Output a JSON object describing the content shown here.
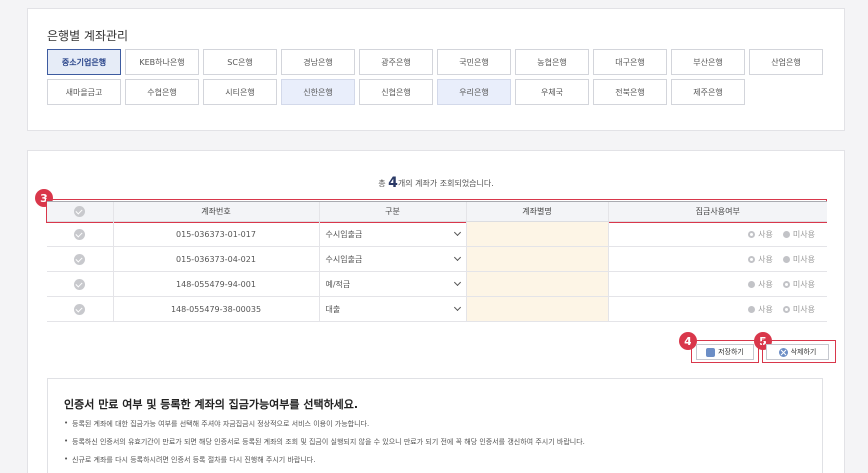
{
  "bank_panel": {
    "title": "은행별 계좌관리",
    "rows": [
      [
        {
          "label": "중소기업은행",
          "state": "selected"
        },
        {
          "label": "KEB하나은행",
          "state": ""
        },
        {
          "label": "SC은행",
          "state": ""
        },
        {
          "label": "경남은행",
          "state": ""
        },
        {
          "label": "광주은행",
          "state": ""
        },
        {
          "label": "국민은행",
          "state": ""
        },
        {
          "label": "농협은행",
          "state": ""
        },
        {
          "label": "대구은행",
          "state": ""
        },
        {
          "label": "부산은행",
          "state": ""
        },
        {
          "label": "산업은행",
          "state": ""
        }
      ],
      [
        {
          "label": "새마을금고",
          "state": ""
        },
        {
          "label": "수협은행",
          "state": ""
        },
        {
          "label": "시티은행",
          "state": ""
        },
        {
          "label": "신한은행",
          "state": "highlight"
        },
        {
          "label": "신협은행",
          "state": ""
        },
        {
          "label": "우리은행",
          "state": "highlight"
        },
        {
          "label": "우체국",
          "state": ""
        },
        {
          "label": "전북은행",
          "state": ""
        },
        {
          "label": "제주은행",
          "state": ""
        }
      ]
    ]
  },
  "summary": {
    "prefix": "총",
    "count": "4",
    "suffix": "개의 계좌가 조회되었습니다."
  },
  "annotations": {
    "table_marker": "3",
    "save_marker": "4",
    "delete_marker": "5"
  },
  "table": {
    "headers": {
      "account_no": "계좌번호",
      "type": "구분",
      "nickname": "계좌별명",
      "collect": "집금사용여부"
    },
    "radio_labels": {
      "use": "사용",
      "unuse": "미사용"
    },
    "rows": [
      {
        "account_no": "015-036373-01-017",
        "type": "수시입출금",
        "use_selected": false
      },
      {
        "account_no": "015-036373-04-021",
        "type": "수시입출금",
        "use_selected": false
      },
      {
        "account_no": "148-055479-94-001",
        "type": "예/적금",
        "use_selected": false
      },
      {
        "account_no": "148-055479-38-00035",
        "type": "대출",
        "use_selected": false
      }
    ]
  },
  "actions": {
    "save_label": "저장하기",
    "delete_label": "삭제하기"
  },
  "notice": {
    "title": "인증서 만료 여부 및 등록한 계좌의 집금가능여부를 선택하세요.",
    "items": [
      "등록된 계좌에 대한 집금가능 여부를 선택해 주셔야 자금집금시 정상적으로 서비스 이용이 가능합니다.",
      "등록하신 인증서의 유효기간이 만료가 되면 해당 인증서로 등록된 계좌의 조회 및 집금이 실행되지 않을 수 있으니 만료가 되기 전에 꼭 해당 인증서를 갱신하여 주시기 바랍니다.",
      "신규로 계좌를 다시 등록하시려면 인증서 등록 절차를 다시 진행해 주시기 바랍니다."
    ]
  },
  "colors": {
    "accent": "#d9374b",
    "selected_bank": "#3d5ba0",
    "nickname_bg": "#fdf5e6"
  }
}
